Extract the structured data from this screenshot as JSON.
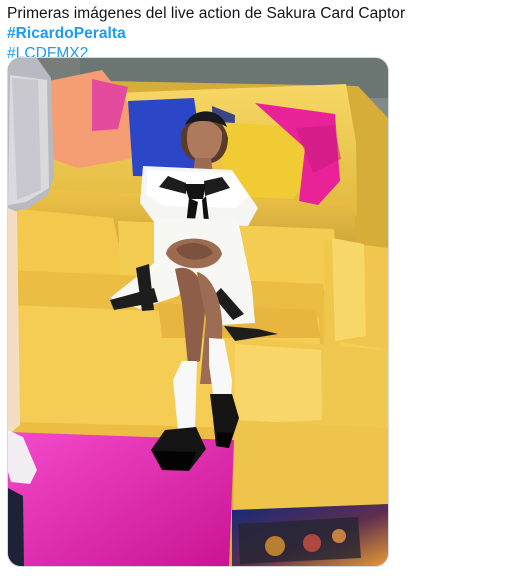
{
  "tweet": {
    "text_main": "Primeras imágenes del live action de Sakura Card Captor ",
    "hashtags": [
      "#RicardoPeralta",
      "#LCDFMX2"
    ],
    "media": {
      "description_icon": "photo-icon",
      "colors": {
        "couch_yellow": "#f4c84e",
        "couch_shadow": "#d3a938",
        "pillow_orange": "#f4a172",
        "pillow_pink": "#e61f8e",
        "pillow_blue": "#2b44c9",
        "pillow_yellow": "#f0cc35",
        "floor_magenta": "#f02ab5",
        "background_gray": "#7d8787",
        "outfit_white": "#f5f5f3",
        "bow_black": "#111111"
      }
    }
  }
}
